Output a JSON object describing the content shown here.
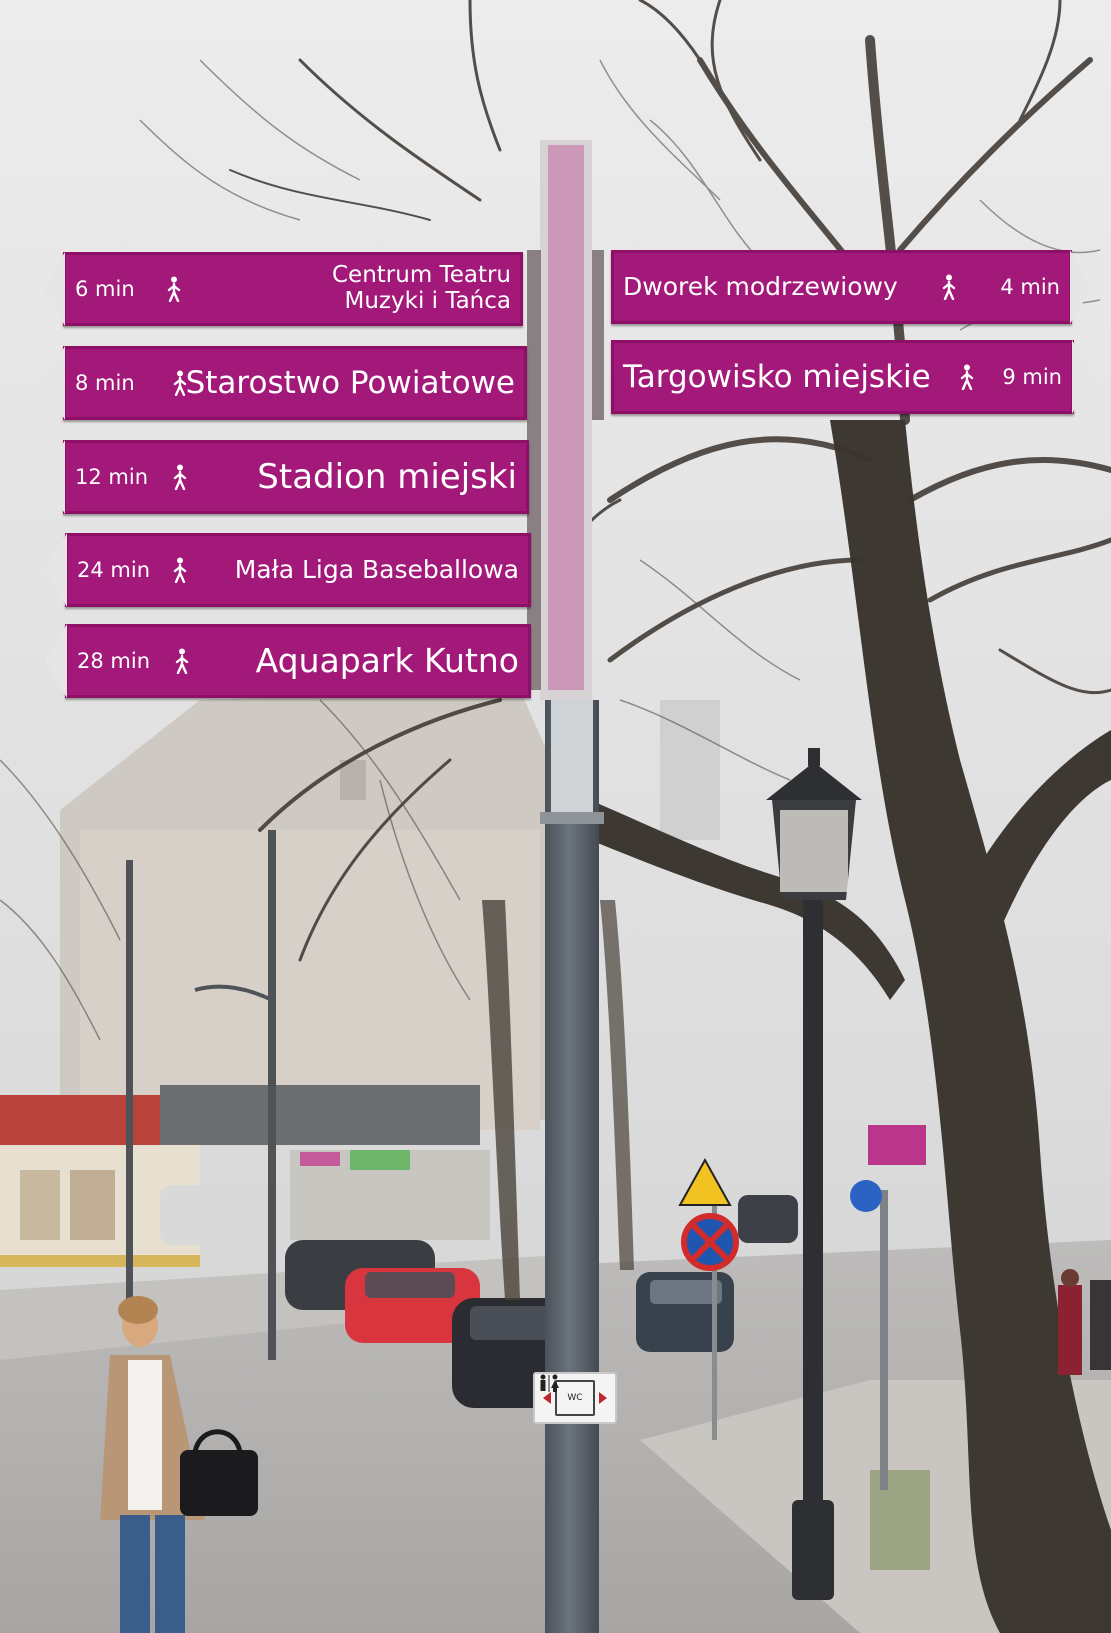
{
  "image": {
    "description_hidden": "",
    "sign_color": "#a31979",
    "pole_color": "#59626b"
  },
  "signs": {
    "left": [
      {
        "time": "6 min",
        "dest": "Centrum Teatru",
        "dest_line2": "Muzyki i Tańca",
        "icon": "pedestrian-icon"
      },
      {
        "time": "8 min",
        "dest": "Starostwo Powiatowe",
        "dest_line2": "",
        "icon": "pedestrian-icon"
      },
      {
        "time": "12 min",
        "dest": "Stadion miejski",
        "dest_line2": "",
        "icon": "pedestrian-icon"
      },
      {
        "time": "24 min",
        "dest": "Mała Liga Baseballowa",
        "dest_line2": "",
        "icon": "pedestrian-icon"
      },
      {
        "time": "28 min",
        "dest": "Aquapark Kutno",
        "dest_line2": "",
        "icon": "pedestrian-icon"
      }
    ],
    "right": [
      {
        "time": "4 min",
        "dest": "Dworek modrzewiowy",
        "icon": "pedestrian-icon"
      },
      {
        "time": "9 min",
        "dest": "Targowisko miejskie",
        "icon": "pedestrian-icon"
      }
    ]
  },
  "wc_plate": {
    "label": "WC",
    "icon": "toilet-icon"
  }
}
